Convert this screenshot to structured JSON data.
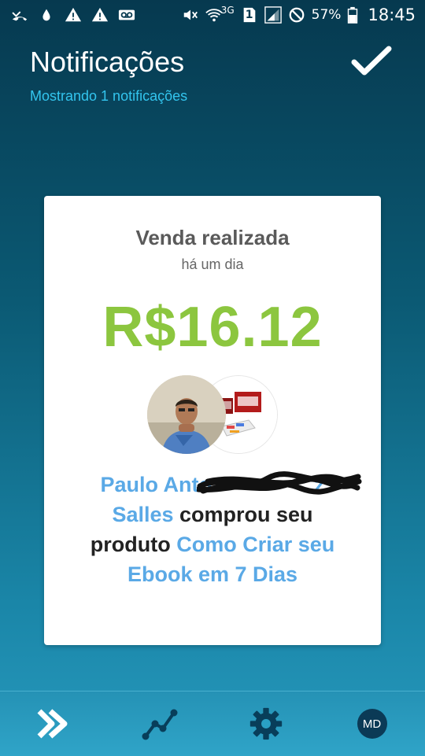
{
  "status_bar": {
    "left_icons": [
      "missed-call-icon",
      "drop-icon",
      "warning-icon",
      "warning-icon",
      "voicemail-icon"
    ],
    "right_icons": [
      "mute-icon",
      "wifi-icon",
      "sim-icon",
      "signal-icon",
      "do-not-disturb-icon",
      "battery-icon"
    ],
    "network": "3G",
    "sim_number": "1",
    "battery": "57%",
    "time": "18:45"
  },
  "header": {
    "title": "Notificações",
    "subtitle": "Mostrando 1 notificações",
    "confirm_icon": "check-icon"
  },
  "notification": {
    "title": "Venda realizada",
    "time": "há um dia",
    "amount": "R$16.12",
    "amount_color": "#8cc63f",
    "buyer_name": "Paulo Anto",
    "buyer_name_end": "z Salles",
    "action_text": " comprou seu produto ",
    "product_name": "Como Criar seu Ebook em 7 Dias",
    "link_color": "#5aa9e6"
  },
  "bottom_nav": {
    "items": [
      "sales-icon",
      "chart-icon",
      "gear-icon",
      "profile"
    ],
    "profile_initials": "MD"
  },
  "colors": {
    "accent": "#33c5ee",
    "background_top": "#06394f",
    "background_bottom": "#2799bd"
  }
}
